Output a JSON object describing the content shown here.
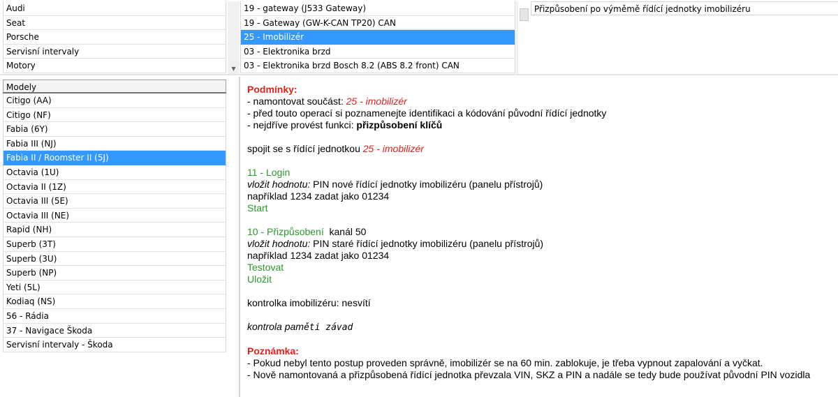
{
  "brands": {
    "items": [
      "Audi",
      "Seat",
      "Porsche",
      "Servisní intervaly",
      "Motory"
    ]
  },
  "modules": {
    "items": [
      "19 - gateway (J533 Gateway)",
      "19 - Gateway (GW-K-CAN TP20) CAN",
      "25 - Imobilizér",
      "03 - Elektronika brzd",
      "03 - Elektronika brzd Bosch 8.2 (ABS 8.2 front) CAN"
    ],
    "selected_index": 2
  },
  "functions": {
    "items": [
      "Přizpůsobení po výměmě řídící jednotky imobilizéru"
    ]
  },
  "models": {
    "header": "Modely",
    "items": [
      "Citigo (AA)",
      "Citigo (NF)",
      "Fabia (6Y)",
      "Fabia III (NJ)",
      "Fabia II / Roomster II (5J)",
      "Octavia (1U)",
      "Octavia II (1Z)",
      "Octavia III (5E)",
      "Octavia III (NE)",
      "Rapid (NH)",
      "Superb (3T)",
      "Superb (3U)",
      "Superb (NP)",
      "Yeti (5L)",
      "Kodiaq (NS)",
      "56 - Rádia",
      "37 - Navigace Škoda",
      "Servisní intervaly - Škoda"
    ],
    "selected_index": 4
  },
  "content": {
    "conditions_title": "Podmínky:",
    "cond1_prefix": "- namontovat součást: ",
    "cond1_value": "25 - imobilizér",
    "cond2": "- před touto operací si poznamenejte identifikaci a kódování původní řídící jednotky",
    "cond3_prefix": "- nejdříve provést funkci: ",
    "cond3_value": "přizpůsobení klíčů",
    "connect_prefix": "spojit se s řídící jednotkou ",
    "connect_value": "25 - imobilizér",
    "login_title": "11 - Login",
    "login_label": "vložit hodnotu:",
    "login_value": " PIN nové řídící jednotky imobilizéru (panelu přístrojů)",
    "login_example": "například 1234 zadat jako 01234",
    "login_action": "Start",
    "adapt_title": "10 - Přizpůsobení",
    "adapt_channel": "  kanál 50",
    "adapt_label": "vložit hodnotu:",
    "adapt_value": " PIN staré řídící jednotky imobilizéru (panelu přístrojů)",
    "adapt_example": "například 1234 zadat jako 01234",
    "adapt_test": "Testovat",
    "adapt_save": "Uložit",
    "lamp": "kontrolka imobilizéru: nesvítí",
    "fault_prefix": "kontrola pam",
    "fault_mono": "ěti závad",
    "note_title": "Poznámka:",
    "note1": "- Pokud nebyl tento postup proveden správně, imobilizér se na 60 min. zablokuje, je třeba vypnout zapalování a vyčkat.",
    "note2": "- Nově namontovaná a přizpůsobená řídící jednotka převzala VIN, SKZ a PIN a nadále se tedy bude používat původní PIN vozidla"
  },
  "icons": {
    "scroll_down": "chevron-down-icon",
    "scroll_up": "chevron-up-icon"
  }
}
